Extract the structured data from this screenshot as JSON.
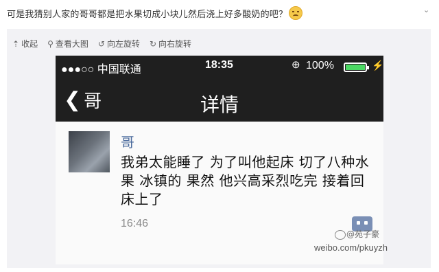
{
  "post": {
    "caption": "可是我猜别人家的哥哥都是把水果切成小块儿然后浇上好多酸奶的吧？"
  },
  "toolbar": {
    "collapse": "收起",
    "view_large": "查看大图",
    "rotate_left": "向左旋转",
    "rotate_right": "向右旋转"
  },
  "statusbar": {
    "carrier": "●●●○○ 中国联通",
    "time": "18:35",
    "battery_pct": "100%",
    "battery_level": 1.0
  },
  "navbar": {
    "back_label": "哥",
    "title": "详情"
  },
  "message": {
    "sender": "哥",
    "text": "我弟太能睡了 为了叫他起床 切了八种水果 冰镇的 果然 他兴高采烈吃完 接着回床上了",
    "time": "16:46"
  },
  "watermark": {
    "name": "@苑子豪",
    "url": "weibo.com/pkuyzh"
  },
  "colors": {
    "phone_bar": "#1f1f1f",
    "battery_fill": "#4cd964",
    "sender": "#4a6a9c"
  }
}
